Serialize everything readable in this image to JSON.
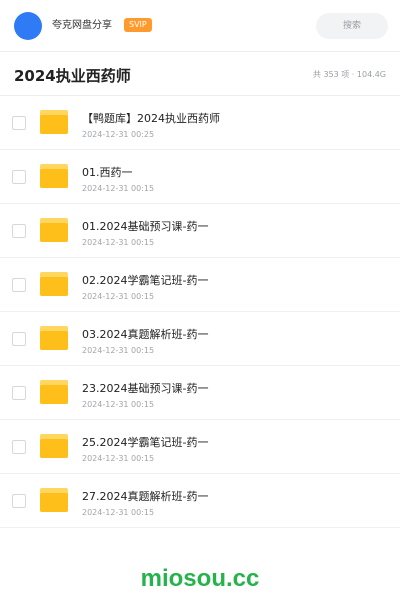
{
  "topbar": {
    "username": "夸克网盘分享",
    "badge": "SVIP",
    "search_placeholder": "搜索"
  },
  "header": {
    "title": "2024执业西药师",
    "summary": "共 353 项 · 104.4G"
  },
  "files": [
    {
      "name": "【鸭题库】2024执业西药师",
      "date": "2024-12-31 00:25"
    },
    {
      "name": "01.西药一",
      "date": "2024-12-31 00:15"
    },
    {
      "name": "01.2024基础预习课-药一",
      "date": "2024-12-31 00:15"
    },
    {
      "name": "02.2024学霸笔记班-药一",
      "date": "2024-12-31 00:15"
    },
    {
      "name": "03.2024真题解析班-药一",
      "date": "2024-12-31 00:15"
    },
    {
      "name": "23.2024基础预习课-药一",
      "date": "2024-12-31 00:15"
    },
    {
      "name": "25.2024学霸笔记班-药一",
      "date": "2024-12-31 00:15"
    },
    {
      "name": "27.2024真题解析班-药一",
      "date": "2024-12-31 00:15"
    }
  ],
  "watermark": "miosou.cc",
  "colors": {
    "accent": "#2f7bf5",
    "badge": "#ff9a2e",
    "folder": "#ffbf1a",
    "watermark": "#26b34c"
  }
}
